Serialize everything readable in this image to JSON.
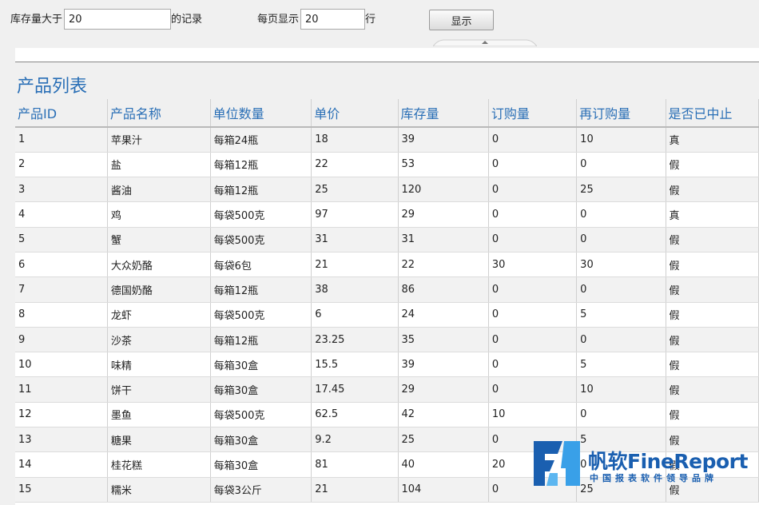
{
  "params": {
    "stock_prefix": "库存量大于",
    "stock_value": "20",
    "stock_suffix": "的记录",
    "page_size_prefix": "每页显示",
    "page_size_value": "20",
    "page_size_suffix": "行",
    "show_button": "显示"
  },
  "report": {
    "title": "产品列表",
    "columns": [
      "产品ID",
      "产品名称",
      "单位数量",
      "单价",
      "库存量",
      "订购量",
      "再订购量",
      "是否已中止"
    ],
    "rows": [
      [
        "1",
        "苹果汁",
        "每箱24瓶",
        "18",
        "39",
        "0",
        "10",
        "真"
      ],
      [
        "2",
        "盐",
        "每箱12瓶",
        "22",
        "53",
        "0",
        "0",
        "假"
      ],
      [
        "3",
        "酱油",
        "每箱12瓶",
        "25",
        "120",
        "0",
        "25",
        "假"
      ],
      [
        "4",
        "鸡",
        "每袋500克",
        "97",
        "29",
        "0",
        "0",
        "真"
      ],
      [
        "5",
        "蟹",
        "每袋500克",
        "31",
        "31",
        "0",
        "0",
        "假"
      ],
      [
        "6",
        "大众奶酪",
        "每袋6包",
        "21",
        "22",
        "30",
        "30",
        "假"
      ],
      [
        "7",
        "德国奶酪",
        "每箱12瓶",
        "38",
        "86",
        "0",
        "0",
        "假"
      ],
      [
        "8",
        "龙虾",
        "每袋500克",
        "6",
        "24",
        "0",
        "5",
        "假"
      ],
      [
        "9",
        "沙茶",
        "每箱12瓶",
        "23.25",
        "35",
        "0",
        "0",
        "假"
      ],
      [
        "10",
        "味精",
        "每箱30盒",
        "15.5",
        "39",
        "0",
        "5",
        "假"
      ],
      [
        "11",
        "饼干",
        "每箱30盒",
        "17.45",
        "29",
        "0",
        "10",
        "假"
      ],
      [
        "12",
        "墨鱼",
        "每袋500克",
        "62.5",
        "42",
        "10",
        "0",
        "假"
      ],
      [
        "13",
        "糖果",
        "每箱30盒",
        "9.2",
        "25",
        "0",
        "5",
        "假"
      ],
      [
        "14",
        "桂花糕",
        "每箱30盒",
        "81",
        "40",
        "20",
        "0",
        "假"
      ],
      [
        "15",
        "糯米",
        "每袋3公斤",
        "21",
        "104",
        "0",
        "25",
        "假"
      ]
    ]
  },
  "watermark": {
    "brand": "帆软FineReport",
    "slogan": "中国报表软件领导品牌"
  },
  "colors": {
    "accent": "#2a6fb6",
    "brand": "#1a5fb0"
  }
}
